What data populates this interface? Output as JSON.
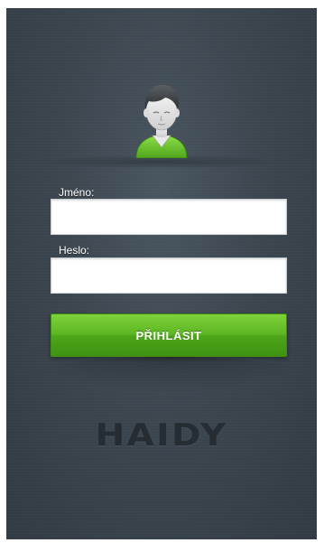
{
  "login_form": {
    "username_label": "Jméno:",
    "username_value": "",
    "password_label": "Heslo:",
    "password_value": "",
    "submit_label": "PŘIHLÁSIT"
  },
  "brand": {
    "logo_text": "HAIDY",
    "tagline": "· · · · · · · · · · · · · · ·"
  },
  "colors": {
    "background": "#3c464f",
    "button_green": "#5cb622",
    "avatar_shirt": "#6cc52a",
    "avatar_hair": "#3a3d40"
  },
  "icons": {
    "avatar": "user-avatar-icon"
  }
}
